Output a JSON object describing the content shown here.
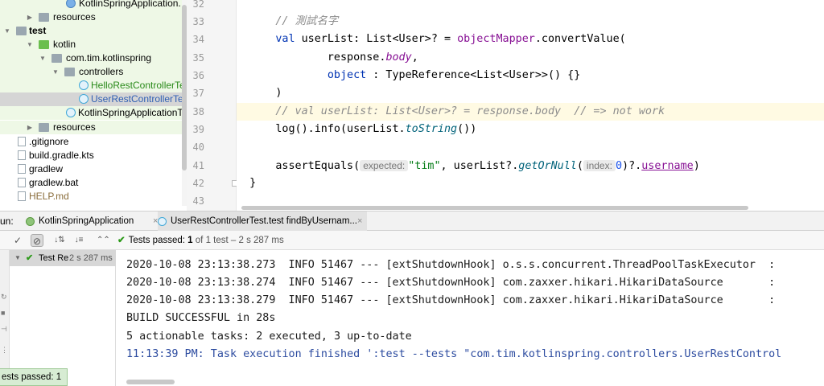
{
  "project_tree": {
    "items": [
      {
        "label": "KotlinSpringApplication.",
        "icon": "kotlin-file-icon"
      },
      {
        "label": "resources",
        "icon": "resources-folder-icon"
      },
      {
        "label": "test",
        "icon": "folder-icon"
      },
      {
        "label": "kotlin",
        "icon": "test-source-folder-icon"
      },
      {
        "label": "com.tim.kotlinspring",
        "icon": "package-icon"
      },
      {
        "label": "controllers",
        "icon": "folder-icon"
      },
      {
        "label": "HelloRestControllerTe",
        "icon": "test-class-icon"
      },
      {
        "label": "UserRestControllerTe",
        "icon": "test-class-icon"
      },
      {
        "label": "KotlinSpringApplicationT",
        "icon": "test-class-icon"
      },
      {
        "label": "resources",
        "icon": "resources-folder-icon"
      },
      {
        "label": ".gitignore",
        "icon": "file-icon"
      },
      {
        "label": "build.gradle.kts",
        "icon": "gradle-file-icon"
      },
      {
        "label": "gradlew",
        "icon": "file-icon"
      },
      {
        "label": "gradlew.bat",
        "icon": "file-icon"
      },
      {
        "label": "HELP.md",
        "icon": "markdown-file-icon"
      }
    ]
  },
  "editor": {
    "line_numbers": [
      "32",
      "33",
      "34",
      "35",
      "36",
      "37",
      "38",
      "39",
      "40",
      "41",
      "42",
      "43"
    ],
    "code": {
      "l33_comment": "// 測試名字",
      "l34_val": "val",
      "l34_decl": " userList: List<User>? = ",
      "l34_obj": "objectMapper",
      "l34_call": ".convertValue(",
      "l35_pre": "response.",
      "l35_prop": "body",
      "l35_post": ",",
      "l36_kw": "object",
      "l36_rest": " : TypeReference<List<User>>() {}",
      "l37": ")",
      "l38_comment": "// val userList: List<User>? = response.body  // => not work",
      "l39_pre": "log().info(userList.",
      "l39_fn": "toString",
      "l39_post": "())",
      "l41_pre": "assertEquals(",
      "l41_hint1": "expected:",
      "l41_str": "\"tim\"",
      "l41_mid": ", userList?.",
      "l41_fn": "getOrNull",
      "l41_open": "(",
      "l41_hint2": "index:",
      "l41_num": "0",
      "l41_close": ")?.",
      "l41_prop": "username",
      "l41_end": ")",
      "l42": "}"
    }
  },
  "run_panel": {
    "label": "un:",
    "tabs": [
      {
        "label": "KotlinSpringApplication",
        "close": "×"
      },
      {
        "label": "UserRestControllerTest.test findByUsernam...",
        "close": "×"
      }
    ],
    "toolbar": {
      "check": "✓",
      "ban": "⊘",
      "sort_alpha": "↓⇅",
      "sort_duration": "↓≡",
      "collapse": "⌃⌃"
    },
    "status": {
      "prefix": "Tests passed:",
      "count": "1",
      "rest": "of 1 test – 2 s 287 ms"
    },
    "test_tree": {
      "name": "Test Re",
      "duration": "2 s 287 ms"
    },
    "console_lines": [
      "2020-10-08 23:13:38.273  INFO 51467 --- [extShutdownHook] o.s.s.concurrent.ThreadPoolTaskExecutor  :",
      "2020-10-08 23:13:38.274  INFO 51467 --- [extShutdownHook] com.zaxxer.hikari.HikariDataSource       :",
      "2020-10-08 23:13:38.279  INFO 51467 --- [extShutdownHook] com.zaxxer.hikari.HikariDataSource       :",
      "BUILD SUCCESSFUL in 28s",
      "5 actionable tasks: 2 executed, 3 up-to-date",
      "11:13:39 PM: Task execution finished ':test --tests \"com.tim.kotlinspring.controllers.UserRestControl"
    ]
  },
  "notification": {
    "text": "ests passed: 1"
  },
  "colors": {
    "keyword": "#0033b3",
    "comment": "#8c8c8c",
    "string": "#067d17",
    "property": "#871094",
    "function": "#00627a",
    "pass_green": "#2d9a1a"
  }
}
